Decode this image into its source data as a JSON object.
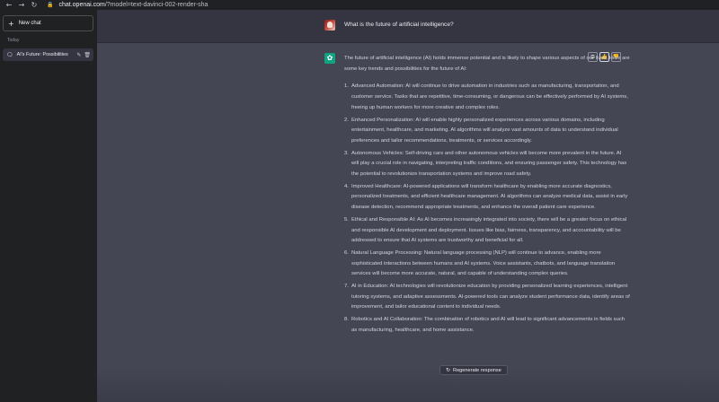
{
  "browser": {
    "back": "←",
    "forward": "→",
    "reload": "↻",
    "url_host": "chat.openai.com",
    "url_path": "/?model=text-davinci-002-render-sha"
  },
  "sidebar": {
    "new_chat_label": "New chat",
    "section_label": "Today",
    "chats": [
      {
        "title": "AI's Future: Possibilities"
      }
    ]
  },
  "conversation": {
    "user_question": "What is the future of artificial intelligence?",
    "intro": "The future of artificial intelligence (AI) holds immense potential and is likely to shape various aspects of our lives. Here are some key trends and possibilities for the future of AI:",
    "points": [
      {
        "num": "1.",
        "text": "Advanced Automation: AI will continue to drive automation in industries such as manufacturing, transportation, and customer service. Tasks that are repetitive, time-consuming, or dangerous can be effectively performed by AI systems, freeing up human workers for more creative and complex roles."
      },
      {
        "num": "2.",
        "text": "Enhanced Personalization: AI will enable highly personalized experiences across various domains, including entertainment, healthcare, and marketing. AI algorithms will analyze vast amounts of data to understand individual preferences and tailor recommendations, treatments, or services accordingly."
      },
      {
        "num": "3.",
        "text": "Autonomous Vehicles: Self-driving cars and other autonomous vehicles will become more prevalent in the future. AI will play a crucial role in navigating, interpreting traffic conditions, and ensuring passenger safety. This technology has the potential to revolutionize transportation systems and improve road safety."
      },
      {
        "num": "4.",
        "text": "Improved Healthcare: AI-powered applications will transform healthcare by enabling more accurate diagnostics, personalized treatments, and efficient healthcare management. AI algorithms can analyze medical data, assist in early disease detection, recommend appropriate treatments, and enhance the overall patient care experience."
      },
      {
        "num": "5.",
        "text": "Ethical and Responsible AI: As AI becomes increasingly integrated into society, there will be a greater focus on ethical and responsible AI development and deployment. Issues like bias, fairness, transparency, and accountability will be addressed to ensure that AI systems are trustworthy and beneficial for all."
      },
      {
        "num": "6.",
        "text": "Natural Language Processing: Natural language processing (NLP) will continue to advance, enabling more sophisticated interactions between humans and AI systems. Voice assistants, chatbots, and language translation services will become more accurate, natural, and capable of understanding complex queries."
      },
      {
        "num": "7.",
        "text": "AI in Education: AI technologies will revolutionize education by providing personalized learning experiences, intelligent tutoring systems, and adaptive assessments. AI-powered tools can analyze student performance data, identify areas of improvement, and tailor educational content to individual needs."
      },
      {
        "num": "8.",
        "text": "Robotics and AI Collaboration: The combination of robotics and AI will lead to significant advancements in fields such as manufacturing, healthcare, and home assistance."
      }
    ]
  },
  "actions": {
    "regenerate_label": "Regenerate response",
    "regenerate_icon": "↻",
    "copy_icon": "⧉",
    "thumbs_up_icon": "👍",
    "thumbs_down_icon": "👎"
  },
  "colors": {
    "accent_green": "#10a37f",
    "sidebar_bg": "#202123",
    "user_bg": "#343541",
    "assistant_bg": "#444654"
  }
}
